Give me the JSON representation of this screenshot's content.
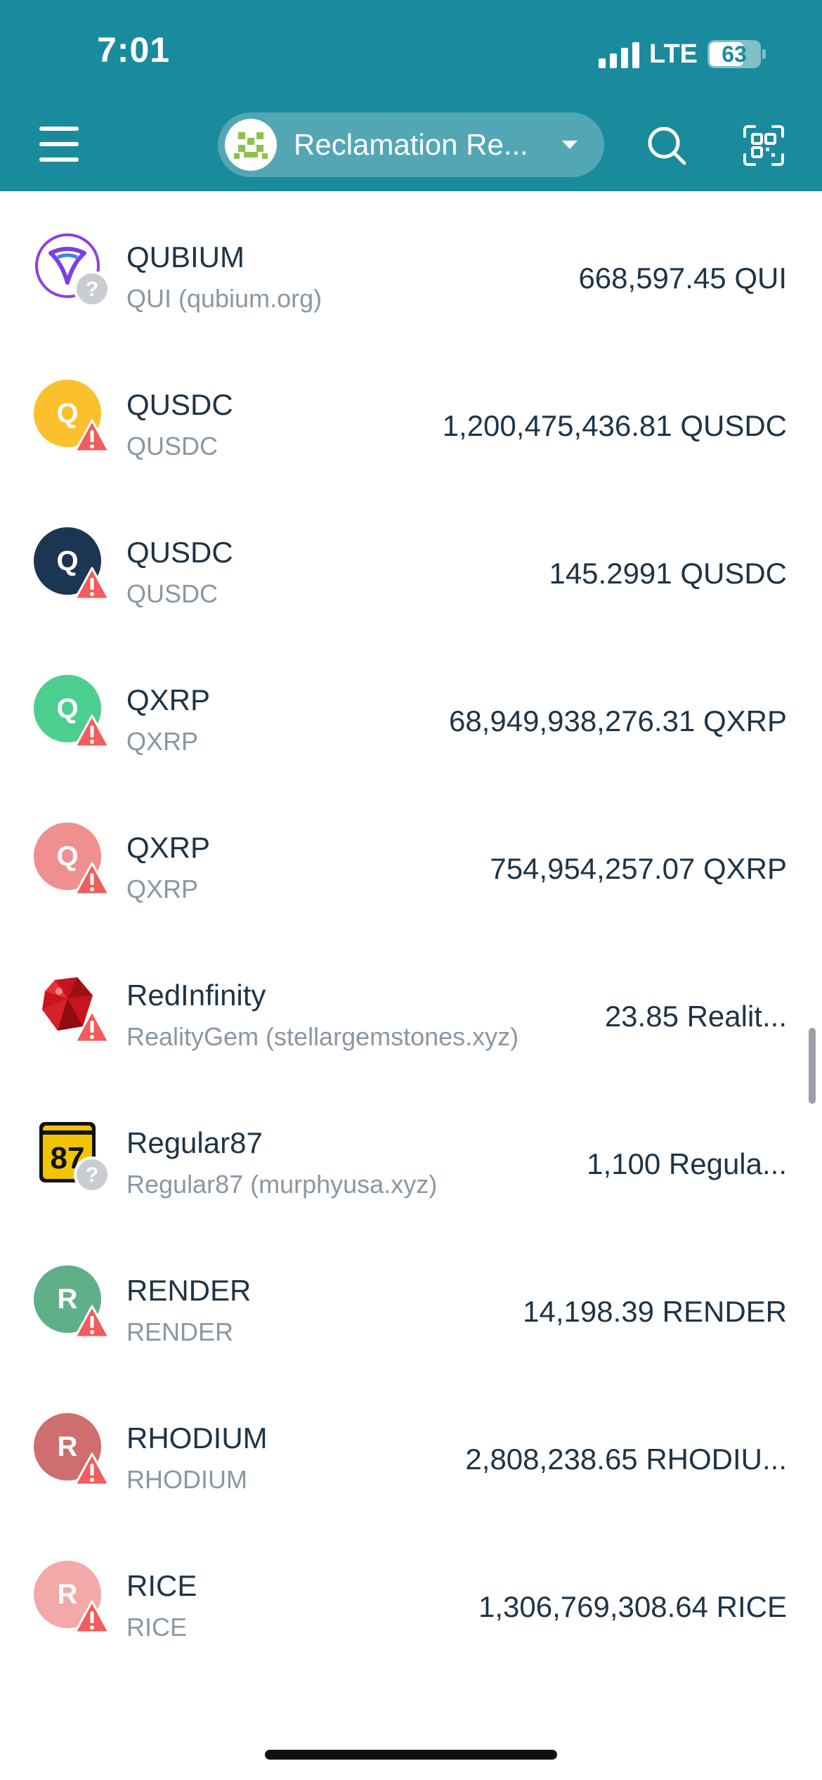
{
  "status_bar": {
    "time": "7:01",
    "network": "LTE",
    "battery": "63",
    "battery_level_percent": 63
  },
  "header": {
    "account_name": "Reclamation Re...",
    "icons": [
      "menu-icon",
      "search-icon",
      "qr-scan-icon"
    ],
    "background_color": "#1a8a9d"
  },
  "tokens": [
    {
      "name": "QUBIUM",
      "subtitle": "QUI (qubium.org)",
      "balance": "668,597.45 QUI",
      "icon_type": "image",
      "icon_letter": "",
      "icon_color": "#7b3fe4",
      "badge": "unknown"
    },
    {
      "name": "QUSDC",
      "subtitle": "QUSDC",
      "balance": "1,200,475,436.81 QUSDC",
      "icon_type": "letter",
      "icon_letter": "Q",
      "icon_color": "#fbc02d",
      "badge": "warning"
    },
    {
      "name": "QUSDC",
      "subtitle": "QUSDC",
      "balance": "145.2991 QUSDC",
      "icon_type": "letter",
      "icon_letter": "Q",
      "icon_color": "#1c3552",
      "badge": "warning"
    },
    {
      "name": "QXRP",
      "subtitle": "QXRP",
      "balance": "68,949,938,276.31 QXRP",
      "icon_type": "letter",
      "icon_letter": "Q",
      "icon_color": "#4cce8e",
      "badge": "warning"
    },
    {
      "name": "QXRP",
      "subtitle": "QXRP",
      "balance": "754,954,257.07 QXRP",
      "icon_type": "letter",
      "icon_letter": "Q",
      "icon_color": "#ef8f8f",
      "badge": "warning"
    },
    {
      "name": "RedInfinity",
      "subtitle": "RealityGem (stellargemstones.xyz)",
      "balance": "23.85 Realit...",
      "icon_type": "image",
      "icon_letter": "",
      "icon_color": "#c9141d",
      "badge": "warning"
    },
    {
      "name": "Regular87",
      "subtitle": "Regular87 (murphyusa.xyz)",
      "balance": "1,100 Regula...",
      "icon_type": "image",
      "icon_letter": "87",
      "icon_color": "#f2c400",
      "badge": "unknown"
    },
    {
      "name": "RENDER",
      "subtitle": "RENDER",
      "balance": "14,198.39 RENDER",
      "icon_type": "letter",
      "icon_letter": "R",
      "icon_color": "#5fb088",
      "badge": "warning"
    },
    {
      "name": "RHODIUM",
      "subtitle": "RHODIUM",
      "balance": "2,808,238.65 RHODIU...",
      "icon_type": "letter",
      "icon_letter": "R",
      "icon_color": "#cf6e6e",
      "badge": "warning"
    },
    {
      "name": "RICE",
      "subtitle": "RICE",
      "balance": "1,306,769,308.64 RICE",
      "icon_type": "letter",
      "icon_letter": "R",
      "icon_color": "#f4a9a9",
      "badge": "warning"
    }
  ]
}
